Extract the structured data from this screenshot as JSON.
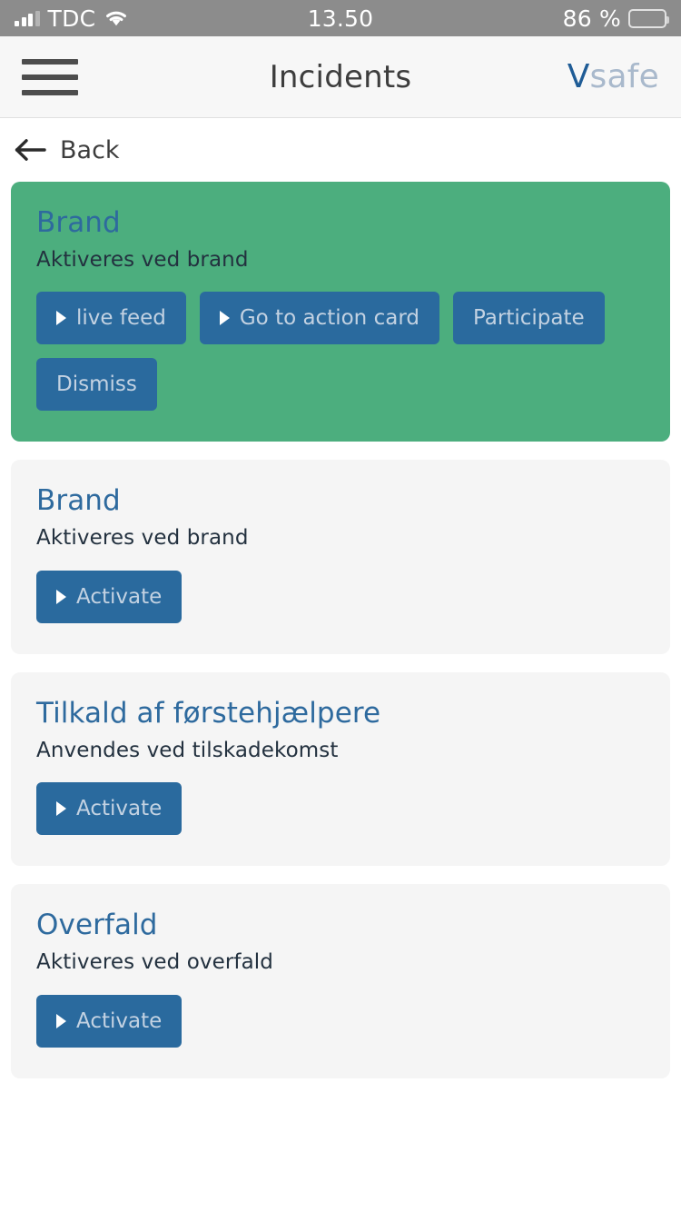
{
  "status_bar": {
    "carrier": "TDC",
    "time": "13.50",
    "battery_percent": "86 %",
    "signal_icon": "signal-bars-icon",
    "wifi_icon": "wifi-icon",
    "battery_icon": "battery-icon"
  },
  "header": {
    "title": "Incidents",
    "menu_icon": "hamburger-menu-icon",
    "logo_primary": "V",
    "logo_secondary": "safe"
  },
  "back_bar": {
    "label": "Back",
    "icon": "arrow-left-icon"
  },
  "colors": {
    "active_card_green": "#4cae7e",
    "inactive_card_gray": "#f5f5f5",
    "button_blue": "#2a6a9e",
    "title_blue": "#2e6a9e",
    "logo_blue": "#1f5c96",
    "status_bar_gray": "#8c8c8c"
  },
  "cards": [
    {
      "title": "Brand",
      "subtitle": "Aktiveres ved brand",
      "state": "active",
      "actions": [
        {
          "label": "live feed",
          "has_arrow": true
        },
        {
          "label": "Go to action card",
          "has_arrow": true
        },
        {
          "label": "Participate",
          "has_arrow": false
        },
        {
          "label": "Dismiss",
          "has_arrow": false
        }
      ]
    },
    {
      "title": "Brand",
      "subtitle": "Aktiveres ved brand",
      "state": "inactive",
      "actions": [
        {
          "label": "Activate",
          "has_arrow": true
        }
      ]
    },
    {
      "title": "Tilkald af førstehjælpere",
      "subtitle": "Anvendes ved tilskadekomst",
      "state": "inactive",
      "actions": [
        {
          "label": "Activate",
          "has_arrow": true
        }
      ]
    },
    {
      "title": "Overfald",
      "subtitle": "Aktiveres ved overfald",
      "state": "inactive",
      "actions": [
        {
          "label": "Activate",
          "has_arrow": true
        }
      ]
    }
  ]
}
